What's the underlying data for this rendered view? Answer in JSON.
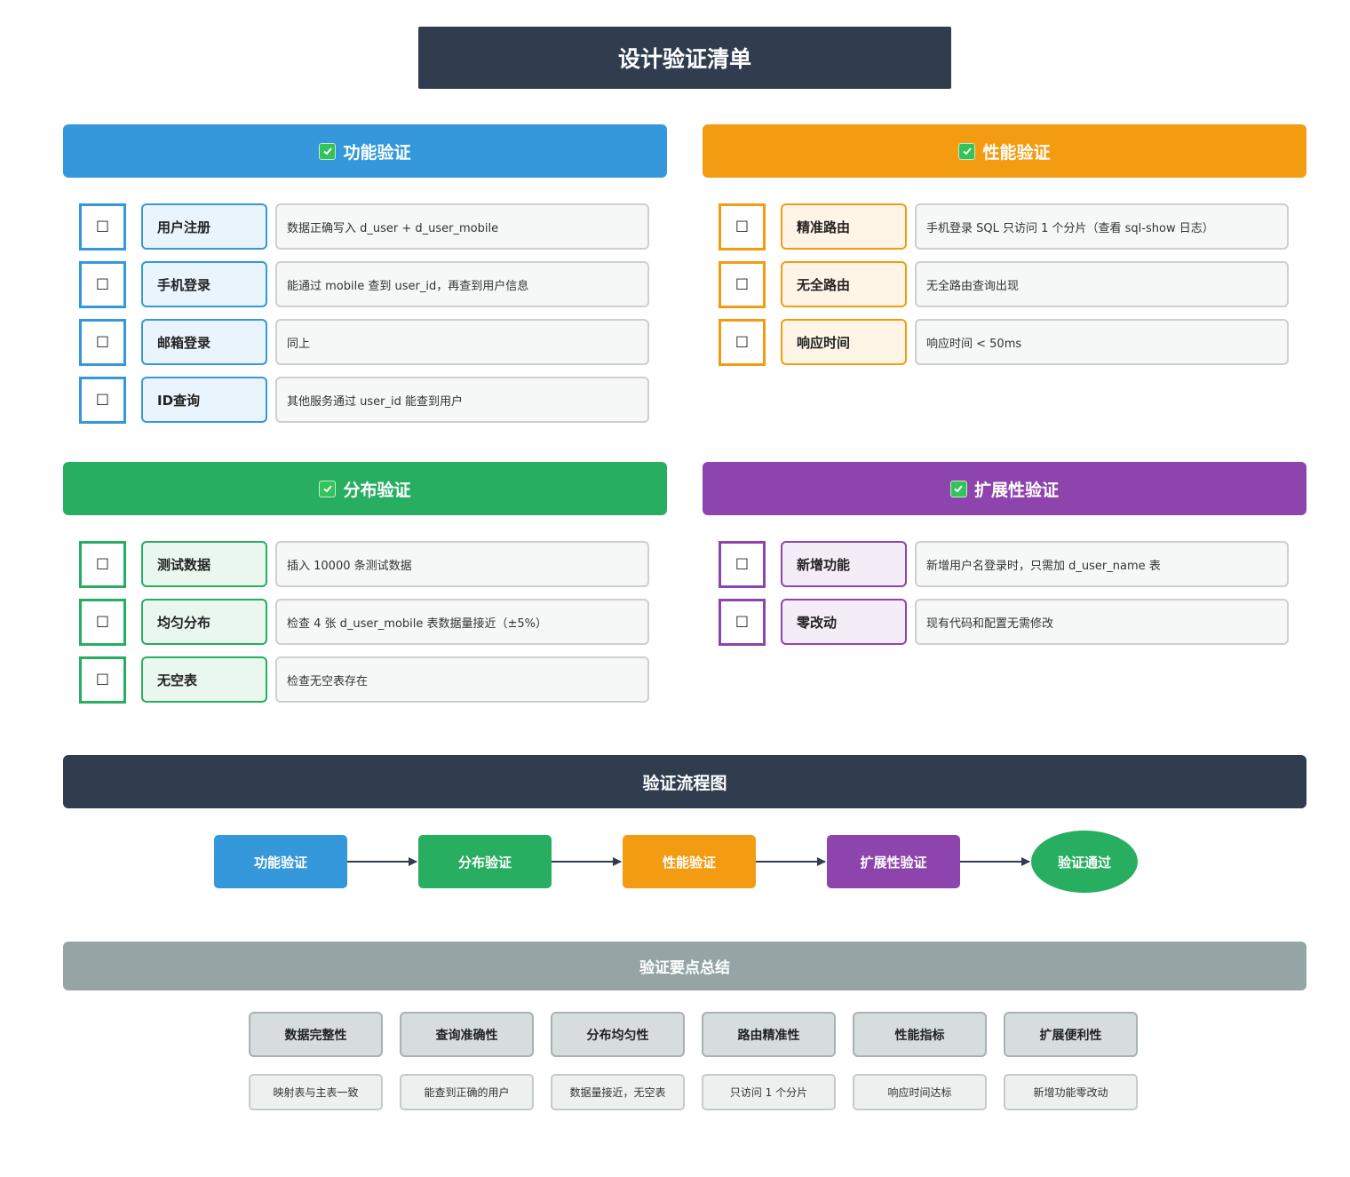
{
  "title": "设计验证清单",
  "sections": {
    "functional": {
      "header": "功能验证",
      "checkbox": "☐",
      "color": "#3498db",
      "items": [
        {
          "label": "用户注册",
          "desc": "数据正确写入 d_user + d_user_mobile"
        },
        {
          "label": "手机登录",
          "desc": "能通过 mobile 查到 user_id，再查到用户信息"
        },
        {
          "label": "邮箱登录",
          "desc": "同上"
        },
        {
          "label": "ID查询",
          "desc": "其他服务通过 user_id 能查到用户"
        }
      ]
    },
    "performance": {
      "header": "性能验证",
      "checkbox": "☐",
      "color": "#f39c12",
      "items": [
        {
          "label": "精准路由",
          "desc": "手机登录 SQL 只访问 1 个分片（查看 sql-show 日志）"
        },
        {
          "label": "无全路由",
          "desc": "无全路由查询出现"
        },
        {
          "label": "响应时间",
          "desc": "响应时间 < 50ms"
        }
      ]
    },
    "distribution": {
      "header": "分布验证",
      "checkbox": "☐",
      "color": "#27ae60",
      "items": [
        {
          "label": "测试数据",
          "desc": "插入 10000 条测试数据"
        },
        {
          "label": "均匀分布",
          "desc": "检查 4 张 d_user_mobile 表数据量接近（±5%）"
        },
        {
          "label": "无空表",
          "desc": "检查无空表存在"
        }
      ]
    },
    "extensibility": {
      "header": "扩展性验证",
      "checkbox": "☐",
      "color": "#8e44ad",
      "items": [
        {
          "label": "新增功能",
          "desc": "新增用户名登录时，只需加 d_user_name 表"
        },
        {
          "label": "零改动",
          "desc": "现有代码和配置无需修改"
        }
      ]
    }
  },
  "flow": {
    "header": "验证流程图",
    "nodes": [
      "功能验证",
      "分布验证",
      "性能验证",
      "扩展性验证"
    ],
    "end": "验证通过"
  },
  "summary": {
    "header": "验证要点总结",
    "points": [
      {
        "label": "数据完整性",
        "desc": "映射表与主表一致"
      },
      {
        "label": "查询准确性",
        "desc": "能查到正确的用户"
      },
      {
        "label": "分布均匀性",
        "desc": "数据量接近，无空表"
      },
      {
        "label": "路由精准性",
        "desc": "只访问 1 个分片"
      },
      {
        "label": "性能指标",
        "desc": "响应时间达标"
      },
      {
        "label": "扩展便利性",
        "desc": "新增功能零改动"
      }
    ]
  }
}
